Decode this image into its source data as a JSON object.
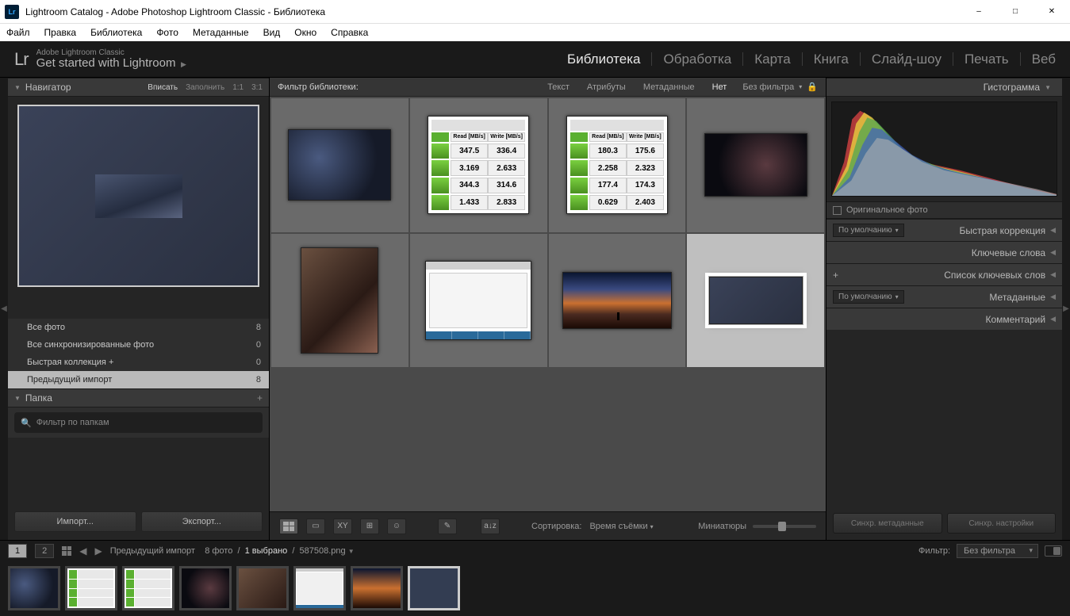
{
  "window": {
    "title": "Lightroom Catalog - Adobe Photoshop Lightroom Classic - Библиотека"
  },
  "menubar": [
    "Файл",
    "Правка",
    "Библиотека",
    "Фото",
    "Метаданные",
    "Вид",
    "Окно",
    "Справка"
  ],
  "identity": {
    "logo": "Lr",
    "line1": "Adobe Lightroom Classic",
    "line2": "Get started with Lightroom"
  },
  "modules": [
    {
      "label": "Библиотека",
      "active": true
    },
    {
      "label": "Обработка",
      "active": false
    },
    {
      "label": "Карта",
      "active": false
    },
    {
      "label": "Книга",
      "active": false
    },
    {
      "label": "Слайд-шоу",
      "active": false
    },
    {
      "label": "Печать",
      "active": false
    },
    {
      "label": "Веб",
      "active": false
    }
  ],
  "navigator": {
    "title": "Навигатор",
    "modes": [
      "Вписать",
      "Заполнить",
      "1:1",
      "3:1"
    ]
  },
  "catalog": {
    "rows": [
      {
        "label": "Все фото",
        "count": 8,
        "selected": false
      },
      {
        "label": "Все синхронизированные фото",
        "count": 0,
        "selected": false
      },
      {
        "label": "Быстрая коллекция  +",
        "count": 0,
        "selected": false
      },
      {
        "label": "Предыдущий импорт",
        "count": 8,
        "selected": true
      }
    ]
  },
  "folders": {
    "title": "Папка",
    "filter_placeholder": "Фильтр по папкам"
  },
  "buttons": {
    "import": "Импорт...",
    "export": "Экспорт..."
  },
  "libfilter": {
    "label": "Фильтр библиотеки:",
    "tabs": [
      "Текст",
      "Атрибуты",
      "Метаданные",
      "Нет"
    ],
    "active_tab": "Нет",
    "preset": "Без фильтра"
  },
  "bench1": {
    "hdr_read": "Read [MB/s]",
    "hdr_write": "Write [MB/s]",
    "rows": [
      [
        "347.5",
        "336.4"
      ],
      [
        "3.169",
        "2.633"
      ],
      [
        "344.3",
        "314.6"
      ],
      [
        "1.433",
        "2.833"
      ]
    ]
  },
  "bench2": {
    "hdr_read": "Read [MB/s]",
    "hdr_write": "Write [MB/s]",
    "rows": [
      [
        "180.3",
        "175.6"
      ],
      [
        "2.258",
        "2.323"
      ],
      [
        "177.4",
        "174.3"
      ],
      [
        "0.629",
        "2.403"
      ]
    ]
  },
  "center_toolbar": {
    "sort_label": "Сортировка:",
    "sort_value": "Время съёмки",
    "thumb_label": "Миниатюры"
  },
  "right": {
    "histogram": "Гистограмма",
    "original_photo": "Оригинальное фото",
    "default_preset": "По умолчанию",
    "panels": {
      "quick_develop": "Быстрая коррекция",
      "keywords": "Ключевые слова",
      "keyword_list": "Список ключевых слов",
      "metadata": "Метаданные",
      "comments": "Комментарий"
    },
    "sync_meta": "Синхр. метаданные",
    "sync_settings": "Синхр. настройки"
  },
  "footer": {
    "pages": [
      "1",
      "2"
    ],
    "breadcrumb": "Предыдущий импорт",
    "stats_photos": "8 фото",
    "stats_selected": "1 выбрано",
    "filename": "587508.png",
    "filter_label": "Фильтр:",
    "filter_preset": "Без фильтра"
  }
}
